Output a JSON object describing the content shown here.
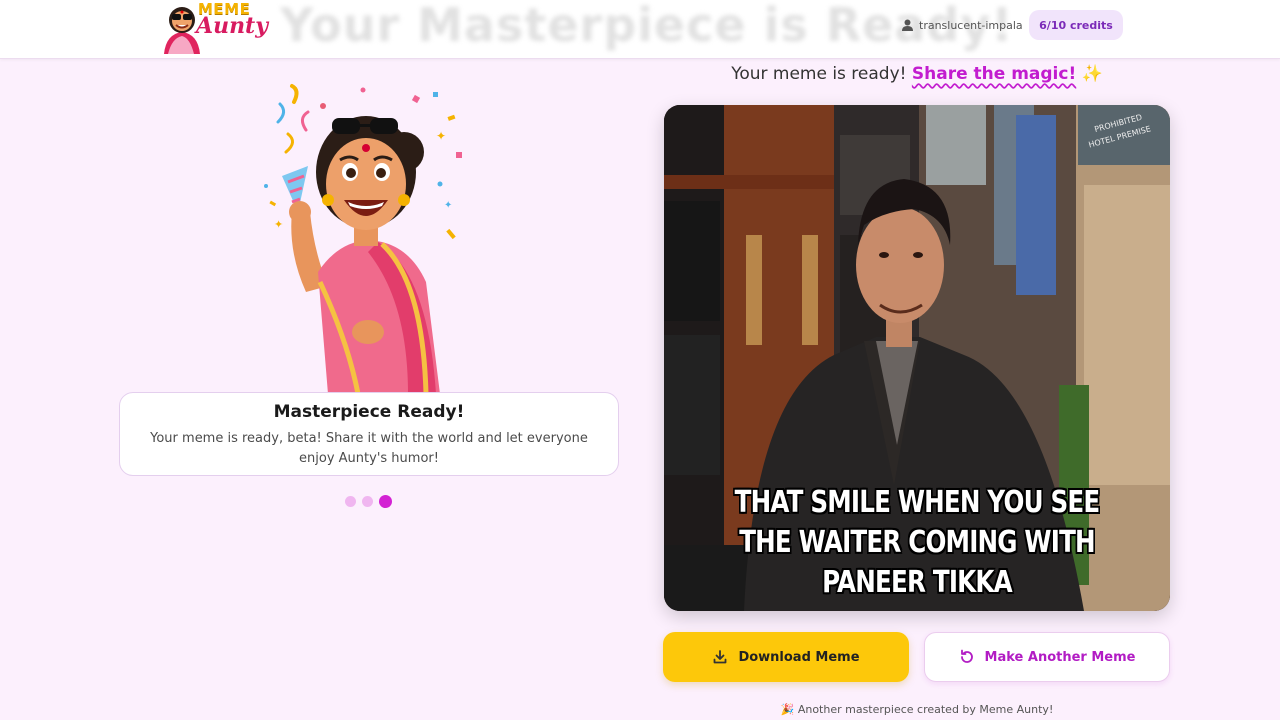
{
  "header": {
    "ghost_title": "Your Masterpiece is Ready!",
    "logo_line1": "MEME",
    "logo_line2": "Aunty",
    "username": "translucent-impala",
    "credits": "6/10 credits"
  },
  "left": {
    "card_title": "Masterpiece Ready!",
    "card_text": "Your meme is ready, beta! Share it with the world and let everyone enjoy Aunty's humor!",
    "progress_dots": 3,
    "active_dot": 3
  },
  "right": {
    "ready_prefix": "Your meme is ready!",
    "ready_highlight": "Share the magic!",
    "sparkle": "✨",
    "meme_caption": "THAT SMILE WHEN YOU SEE THE WAITER COMING WITH PANEER TIKKA",
    "sign_text": "PROHIBITED HOTEL PREMISE",
    "download_label": "Download Meme",
    "another_label": "Make Another Meme",
    "footer_note": "🎉 Another masterpiece created by Meme Aunty!"
  },
  "colors": {
    "accent": "#c21ccf",
    "button_yellow": "#fdc80a",
    "background": "#fcf0fd"
  },
  "icons": [
    "user-icon",
    "download-icon",
    "refresh-icon",
    "sparkle-icon",
    "party-popper-icon"
  ]
}
